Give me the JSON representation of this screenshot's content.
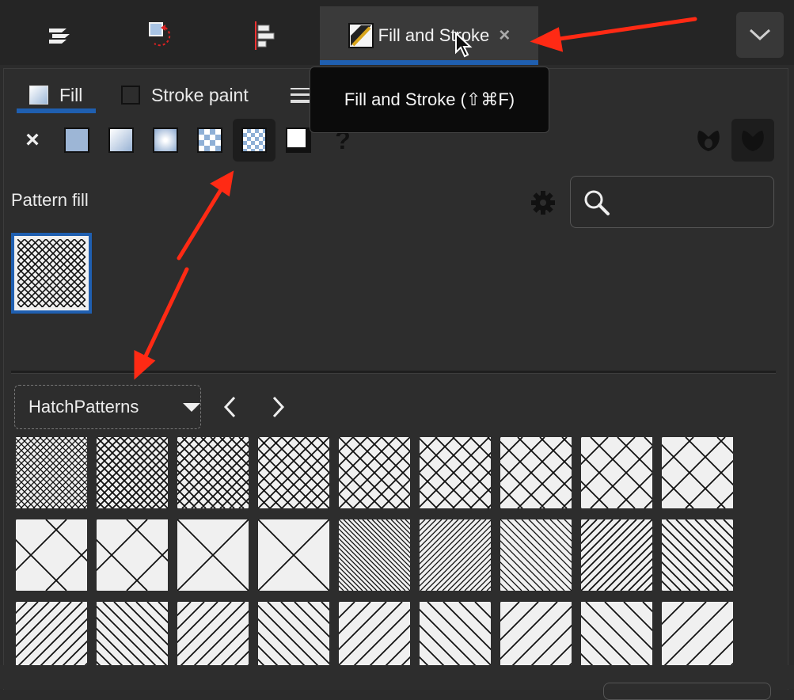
{
  "dock": {
    "tabs": [
      {
        "name": "objects",
        "icon": "layers-icon"
      },
      {
        "name": "transform",
        "icon": "transform-icon"
      },
      {
        "name": "align",
        "icon": "align-icon"
      },
      {
        "name": "fill-and-stroke",
        "label": "Fill and Stroke",
        "icon": "fill-stroke-icon",
        "active": true
      }
    ],
    "close_label": "×",
    "menu_icon": "chevron-down-icon"
  },
  "tooltip": {
    "text": "Fill and Stroke (⇧⌘F)"
  },
  "subtabs": {
    "fill": "Fill",
    "stroke_paint": "Stroke paint",
    "stroke_style": "Stroke style"
  },
  "fill_modes": [
    {
      "name": "no-paint",
      "glyph": "×"
    },
    {
      "name": "flat-color"
    },
    {
      "name": "linear-gradient"
    },
    {
      "name": "radial-gradient"
    },
    {
      "name": "mesh-gradient"
    },
    {
      "name": "pattern",
      "active": true
    },
    {
      "name": "swatch"
    },
    {
      "name": "unset",
      "glyph": "?"
    }
  ],
  "fill_rules": [
    {
      "name": "even-odd"
    },
    {
      "name": "nonzero",
      "active": true
    }
  ],
  "pattern_section": {
    "label": "Pattern fill",
    "search_placeholder": ""
  },
  "collection": {
    "selected": "HatchPatterns",
    "prev_icon": "chevron-left-icon",
    "next_icon": "chevron-right-icon"
  },
  "colors": {
    "accent": "#1f5fb0",
    "annotation_arrow": "#ff2a14",
    "panel_bg": "#2d2d2d",
    "pattern_bg": "#f0f0f0"
  }
}
